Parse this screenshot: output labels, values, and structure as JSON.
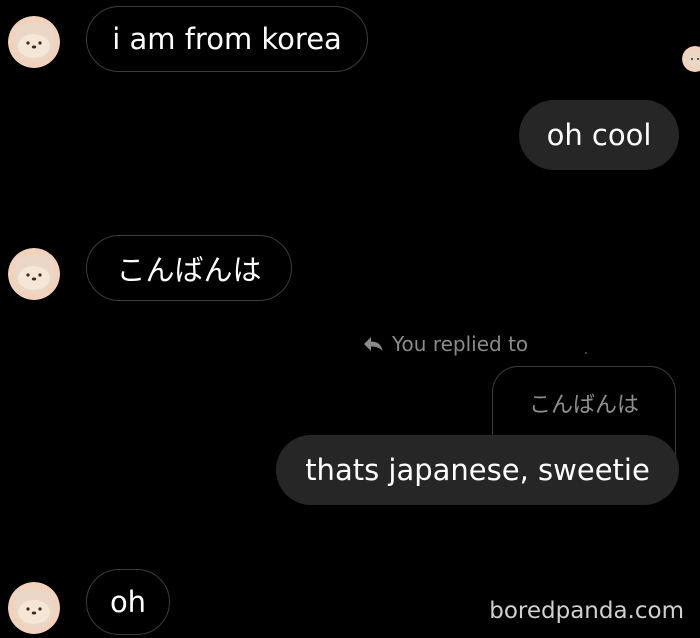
{
  "conversation": {
    "messages": [
      {
        "direction": "incoming",
        "text": "i am from korea"
      },
      {
        "direction": "outgoing",
        "text": "oh cool"
      },
      {
        "direction": "incoming",
        "text": "こんばんは"
      },
      {
        "direction": "outgoing",
        "reply_label": "You replied to",
        "quoted_text": "こんばんは",
        "text": "thats japanese, sweetie"
      },
      {
        "direction": "incoming",
        "text": "oh"
      }
    ]
  },
  "watermark": "boredpanda.com",
  "colors": {
    "background": "#000000",
    "outgoing_bubble": "#262626",
    "incoming_border": "#3b3b3b",
    "muted_text": "#8a8a8a",
    "avatar_face": "#f3d2bd"
  },
  "icons": {
    "avatar": "bear-avatar-icon",
    "reply": "reply-arrow-icon"
  }
}
